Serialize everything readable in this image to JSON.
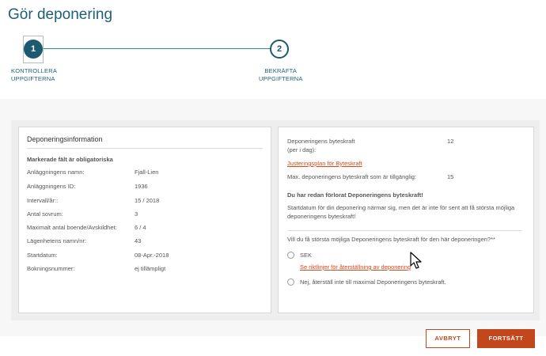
{
  "page": {
    "title": "Gör deponering"
  },
  "stepper": {
    "steps": [
      {
        "number": "1",
        "label_line1": "KONTROLLERA",
        "label_line2": "UPPGIFTERNA"
      },
      {
        "number": "2",
        "label_line1": "BEKRÄFTA",
        "label_line2": "UPPGIFTERNA"
      }
    ]
  },
  "left_card": {
    "title": "Deponeringsinformation",
    "required_note": "Markerade fält är obligatoriska",
    "rows": [
      {
        "label": "Anläggningens namn:",
        "value": "Fjall-Lien"
      },
      {
        "label": "Anläggningens ID:",
        "value": "1936"
      },
      {
        "label": "Intervall/år::",
        "value": "15 / 2018"
      },
      {
        "label": "Antal sovrum:",
        "value": "3"
      },
      {
        "label": "Maximalt antal boende/Avskildhet:",
        "value": "6 / 4"
      },
      {
        "label": "Lägenhetens namn/nr:",
        "value": "43"
      },
      {
        "label": "Startdatum:",
        "value": "08-Apr.-2018"
      },
      {
        "label": "Bokningsnummer:",
        "value": "ej tillämpligt"
      }
    ]
  },
  "right_card": {
    "power_label_line1": "Deponeringens byteskraft",
    "power_label_line2": "(per i dag):",
    "power_value": "12",
    "adjust_link": "Justeringsplan för Byteskraft",
    "max_label": "Max. deponeringens byteskraft som är tillgänglig:",
    "max_value": "15",
    "lost_heading": "Du har redan förlorat Deponeringens byteskraft!",
    "lost_text_line1": "Startdatum för din deponering närmar sig, men det är inte för sent att få största möjliga",
    "lost_text_line2": "deponeringens byteskraft!",
    "question": "Vill du få största möjliga Deponeringens byteskraft för den här deponeringen?**",
    "option1_label": "SEK",
    "option1_link": "Se riktlinjer för återställning av deponering",
    "option2_label": "Nej, återställ inte till maximal Deponeringens byteskraft."
  },
  "buttons": {
    "cancel": "AVBRYT",
    "continue": "FORTSÄTT"
  },
  "colors": {
    "primary": "#1e5f78",
    "accent": "#c2471d",
    "link": "#d9481a"
  }
}
